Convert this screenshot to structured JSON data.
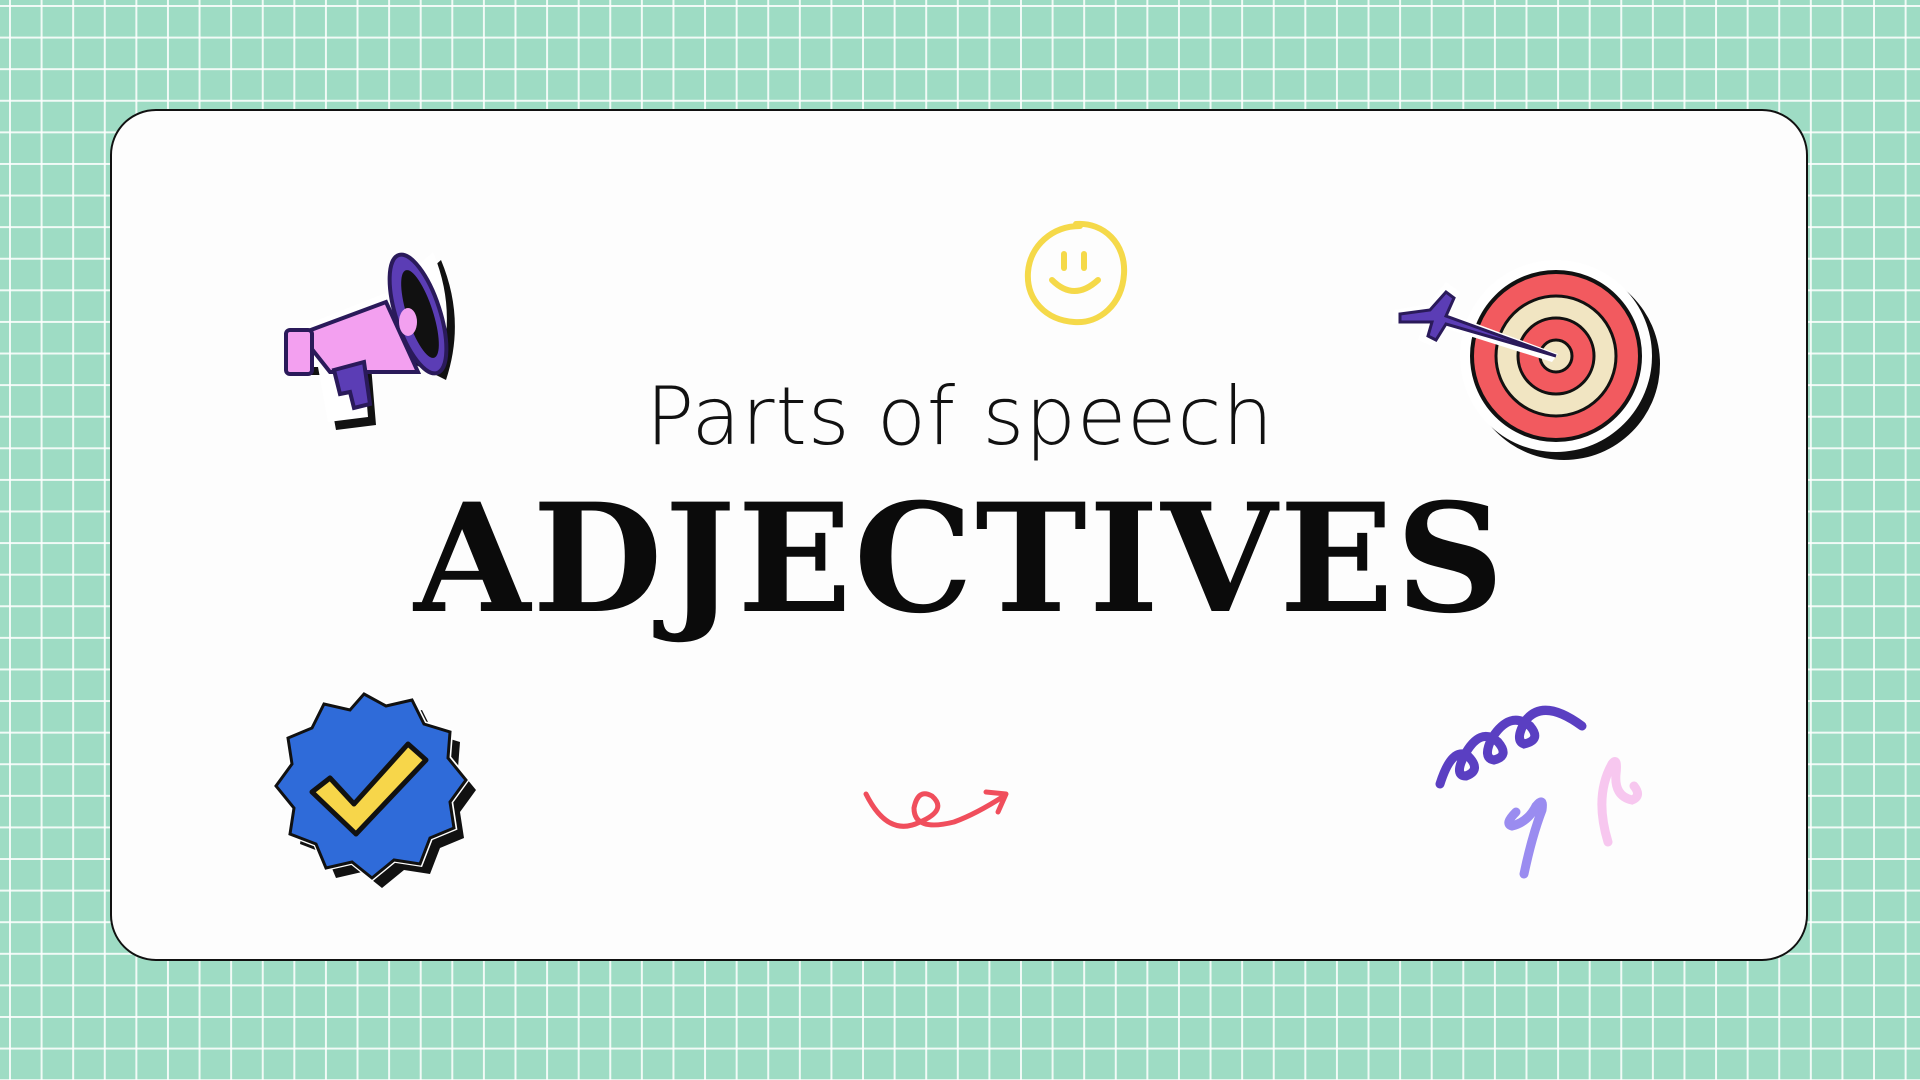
{
  "slide": {
    "subtitle": "Parts of speech",
    "title": "ADJECTIVES"
  },
  "icons": {
    "megaphone": "megaphone-icon",
    "smiley": "smiley-face-icon",
    "target": "target-with-arrow-icon",
    "checkmark_badge": "checkmark-badge-icon",
    "curly_arrow": "curly-arrow-icon",
    "squiggles": "squiggle-doodles-icon"
  },
  "colors": {
    "background": "#9edcc4",
    "grid_line": "#ffffff",
    "card": "#fdfdfd",
    "text": "#111111",
    "megaphone_pink": "#f3a0f0",
    "megaphone_purple": "#5b3db5",
    "smiley_yellow": "#f5d949",
    "target_red": "#f25a5f",
    "target_cream": "#f1e5c2",
    "badge_blue": "#2f6bd9",
    "check_yellow": "#f7d64a",
    "arrow_red": "#f04e5c",
    "squiggle_purple": "#5a3fc2",
    "squiggle_lavender": "#9a8cf0",
    "squiggle_pink": "#f7c7ef"
  }
}
